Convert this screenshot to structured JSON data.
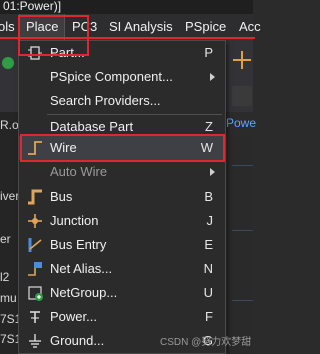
{
  "window": {
    "title_fragment": "01:Power)]"
  },
  "menubar": {
    "items": [
      {
        "label": "ols"
      },
      {
        "label": "Place"
      },
      {
        "label": "PC3"
      },
      {
        "label": "SI Analysis"
      },
      {
        "label": "PSpice"
      },
      {
        "label": "Acc"
      }
    ]
  },
  "background": {
    "left_fragments": [
      "R.o",
      "iver",
      "er",
      "",
      "l2",
      "mu",
      "7S1",
      "7S1",
      "I2"
    ],
    "right_fragment": "Powe"
  },
  "place_menu": {
    "items": [
      {
        "label": "Part...",
        "shortcut": "P",
        "icon": "part-icon"
      },
      {
        "label": "PSpice Component...",
        "submenu": true
      },
      {
        "label": "Search Providers..."
      },
      {
        "label": "Database Part",
        "shortcut": "Z"
      },
      {
        "label": "Wire",
        "shortcut": "W",
        "icon": "wire-icon",
        "highlighted": true
      },
      {
        "label": "Auto Wire",
        "submenu": true,
        "disabled": true
      },
      {
        "label": "Bus",
        "shortcut": "B",
        "icon": "bus-icon"
      },
      {
        "label": "Junction",
        "shortcut": "J",
        "icon": "junction-icon"
      },
      {
        "label": "Bus Entry",
        "shortcut": "E",
        "icon": "bus-entry-icon"
      },
      {
        "label": "Net Alias...",
        "shortcut": "N",
        "icon": "net-alias-icon"
      },
      {
        "label": "NetGroup...",
        "shortcut": "U",
        "icon": "netgroup-icon"
      },
      {
        "label": "Power...",
        "shortcut": "F",
        "icon": "power-icon"
      },
      {
        "label": "Ground...",
        "shortcut": "G",
        "icon": "ground-icon"
      }
    ]
  },
  "watermark": "CSDN @努力欢梦甜",
  "colors": {
    "highlight_border": "#e0262f",
    "accent_blue": "#5aa7ff"
  }
}
